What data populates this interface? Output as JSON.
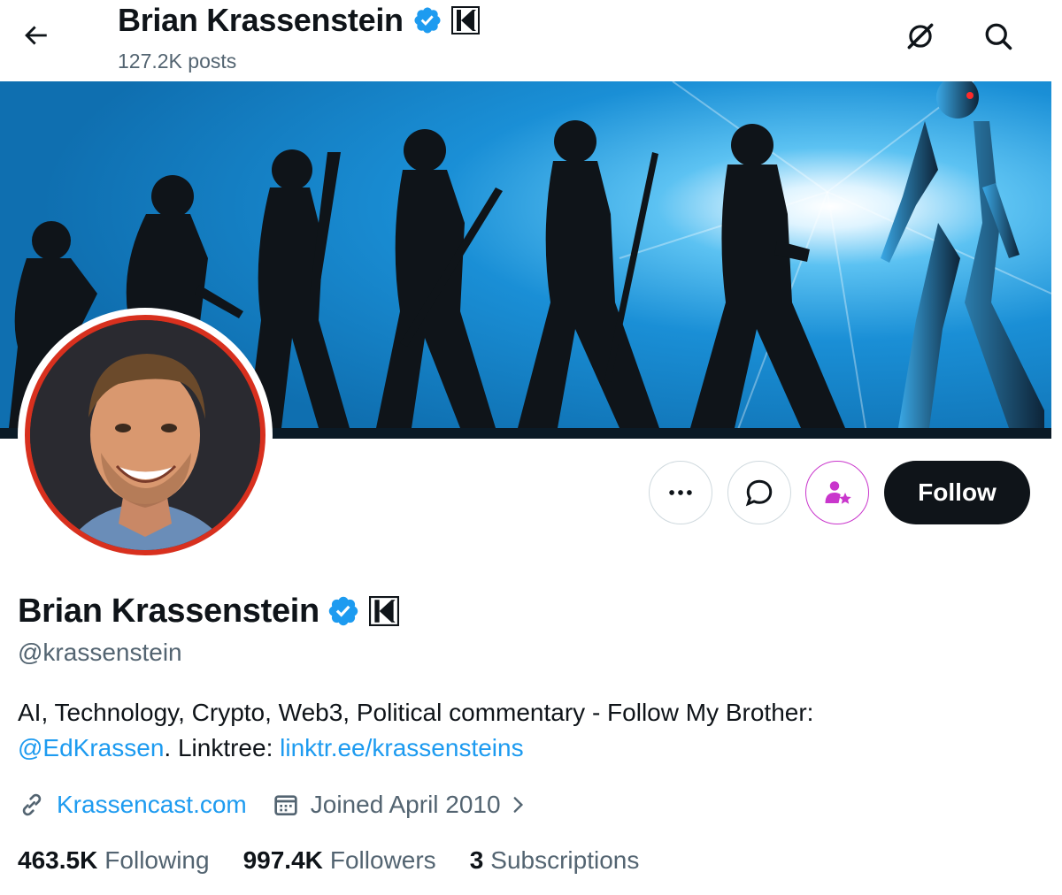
{
  "header": {
    "name": "Brian Krassenstein",
    "posts_count": "127.2K posts",
    "icons": [
      "back-arrow-icon",
      "grok-icon",
      "search-icon"
    ]
  },
  "profile": {
    "name": "Brian Krassenstein",
    "handle": "@krassenstein",
    "bio": {
      "text_part1": "AI, Technology, Crypto, Web3, Political commentary - Follow My Brother: ",
      "mention": "@EdKrassen",
      "text_part2": ". Linktree: ",
      "linktree": "linktr.ee/krassensteins"
    },
    "website": "Krassencast.com",
    "joined": "Joined April 2010"
  },
  "actions": {
    "more_icon": "ellipsis-icon",
    "message_icon": "message-icon",
    "subscribe_icon": "subscribe-star-icon",
    "follow_label": "Follow"
  },
  "stats": {
    "following_count": "463.5K",
    "following_label": "Following",
    "followers_count": "997.4K",
    "followers_label": "Followers",
    "subscriptions_count": "3",
    "subscriptions_label": "Subscriptions"
  },
  "colors": {
    "verified_blue": "#1d9bf0",
    "link_blue": "#1d9bf0",
    "follow_bg": "#0f1419",
    "avatar_ring": "#d8301e",
    "subscribe_accent": "#c936cc",
    "banner_blue": "#1a8fd6"
  }
}
